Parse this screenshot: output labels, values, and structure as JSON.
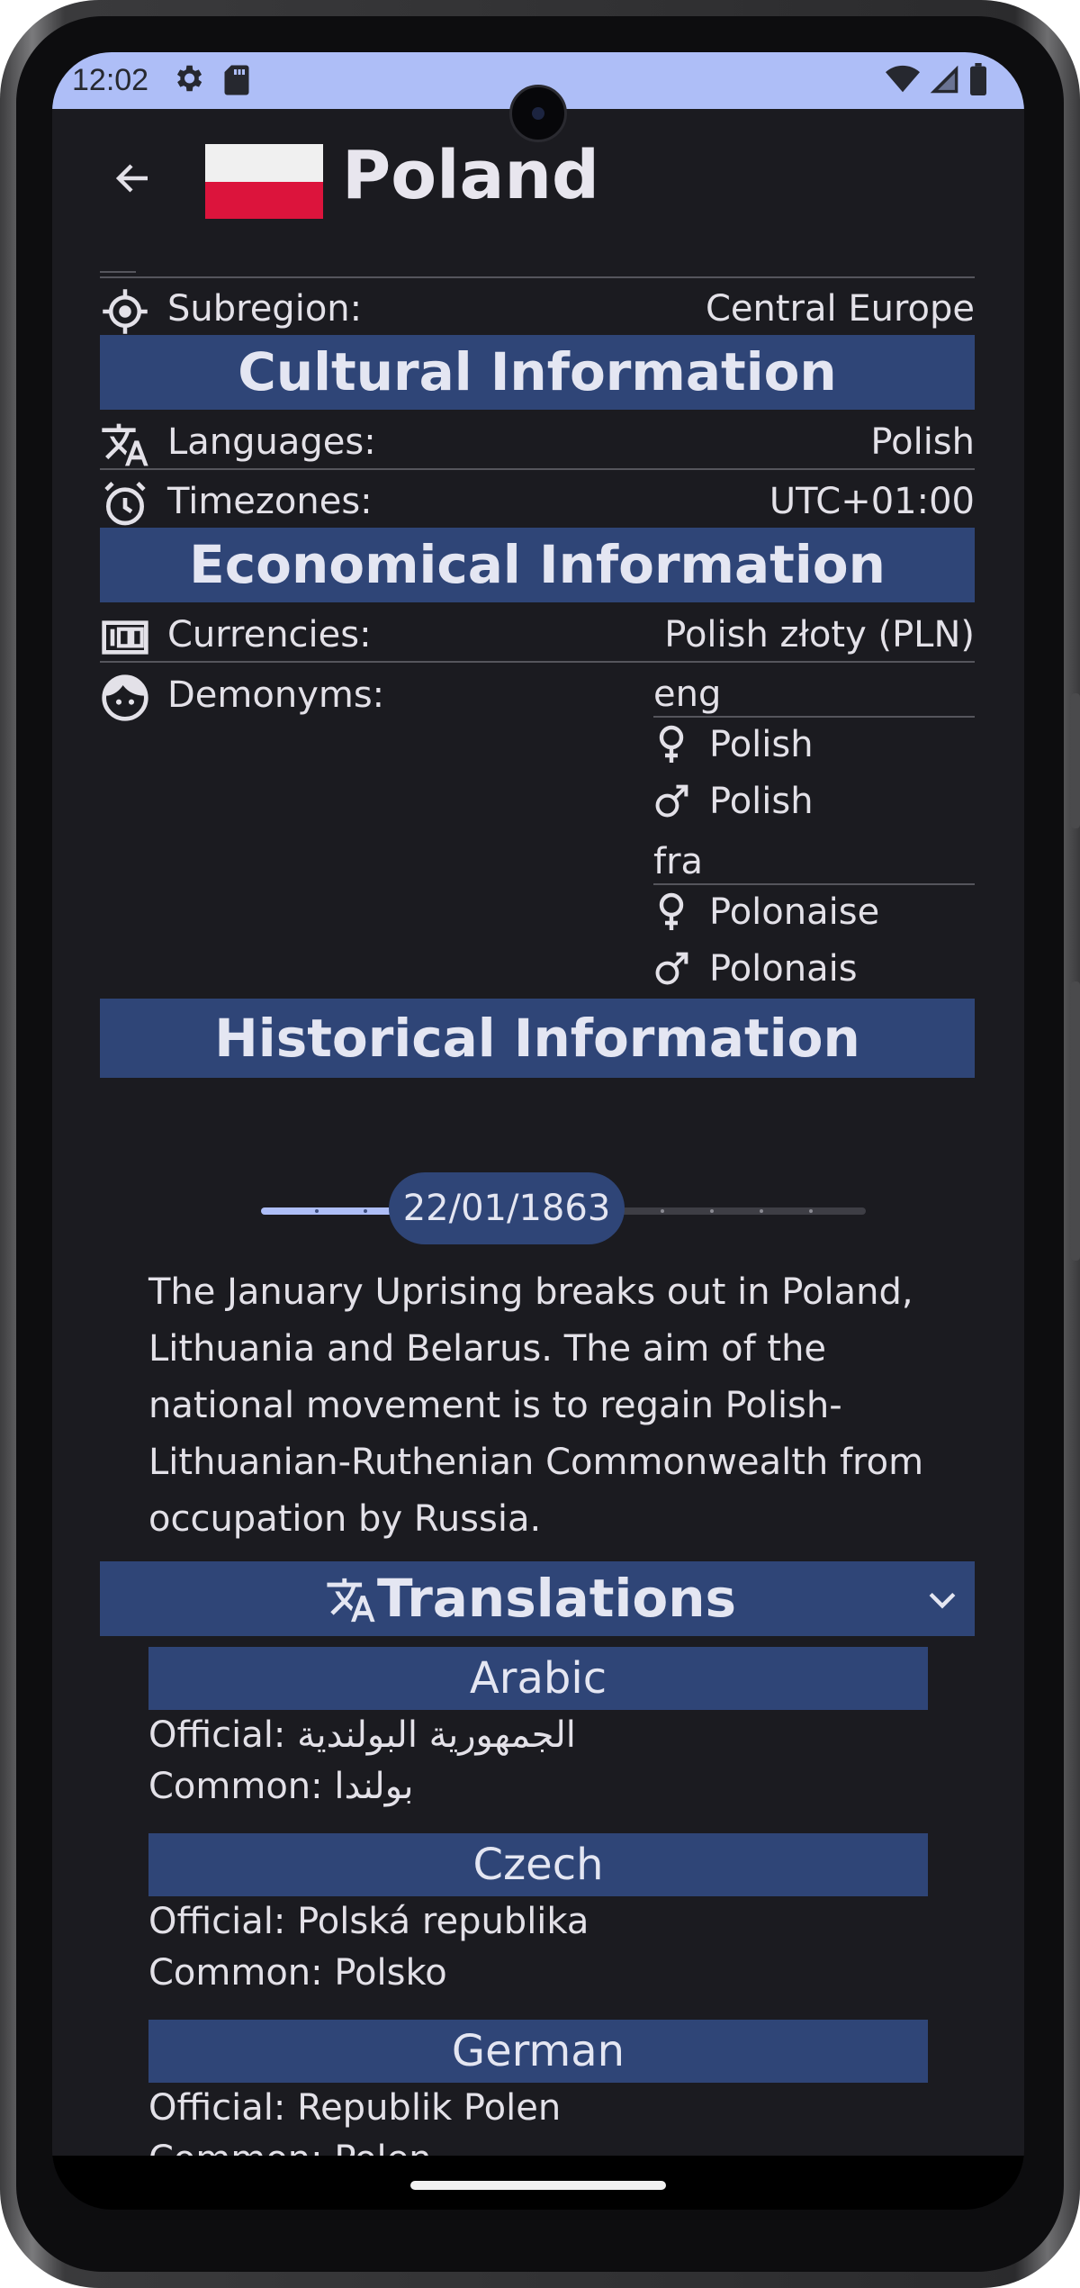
{
  "status_bar": {
    "time": "12:02",
    "icons": [
      "gear-icon",
      "sd-card-icon",
      "wifi-icon",
      "signal-icon",
      "battery-icon"
    ]
  },
  "app_bar": {
    "title": "Poland",
    "back_icon": "arrow-back-icon",
    "flag": "poland-flag"
  },
  "geo": {
    "subregion": {
      "label": "Subregion:",
      "value": "Central Europe",
      "icon": "location-target-icon"
    }
  },
  "sections": {
    "cultural": "Cultural Information",
    "economical": "Economical Information",
    "historical": "Historical Information"
  },
  "cultural": {
    "languages": {
      "label": "Languages:",
      "value": "Polish",
      "icon": "translate-icon"
    },
    "timezones": {
      "label": "Timezones:",
      "value": "UTC+01:00",
      "icon": "alarm-clock-icon"
    }
  },
  "economical": {
    "currencies": {
      "label": "Currencies:",
      "value": "Polish złoty (PLN)",
      "icon": "money-icon"
    },
    "demonyms": {
      "label": "Demonyms:",
      "icon": "face-icon",
      "groups": [
        {
          "lang": "eng",
          "female": "Polish",
          "male": "Polish"
        },
        {
          "lang": "fra",
          "female": "Polonaise",
          "male": "Polonais"
        }
      ]
    }
  },
  "history": {
    "slider_value": "22/01/1863",
    "slider_fraction": 0.35,
    "text": "The January Uprising breaks out in Poland, Lithuania and Belarus. The aim of the national movement is to regain Polish-Lithuanian-Ruthenian Commonwealth from occupation by Russia."
  },
  "translations": {
    "title": "Translations",
    "icon": "translate-icon",
    "expand_icon": "chevron-down-icon",
    "items": [
      {
        "language": "Arabic",
        "official": "Official: الجمهورية البولندية",
        "common": "Common: بولندا"
      },
      {
        "language": "Czech",
        "official": "Official: Polská republika",
        "common": "Common: Polsko"
      },
      {
        "language": "German",
        "official": "Official: Republik Polen",
        "common": "Common: Polen"
      }
    ]
  },
  "colors": {
    "background": "#1b1b20",
    "section": "#2f4577",
    "status_bar": "#aebef7",
    "slider_active": "#aebef7"
  }
}
